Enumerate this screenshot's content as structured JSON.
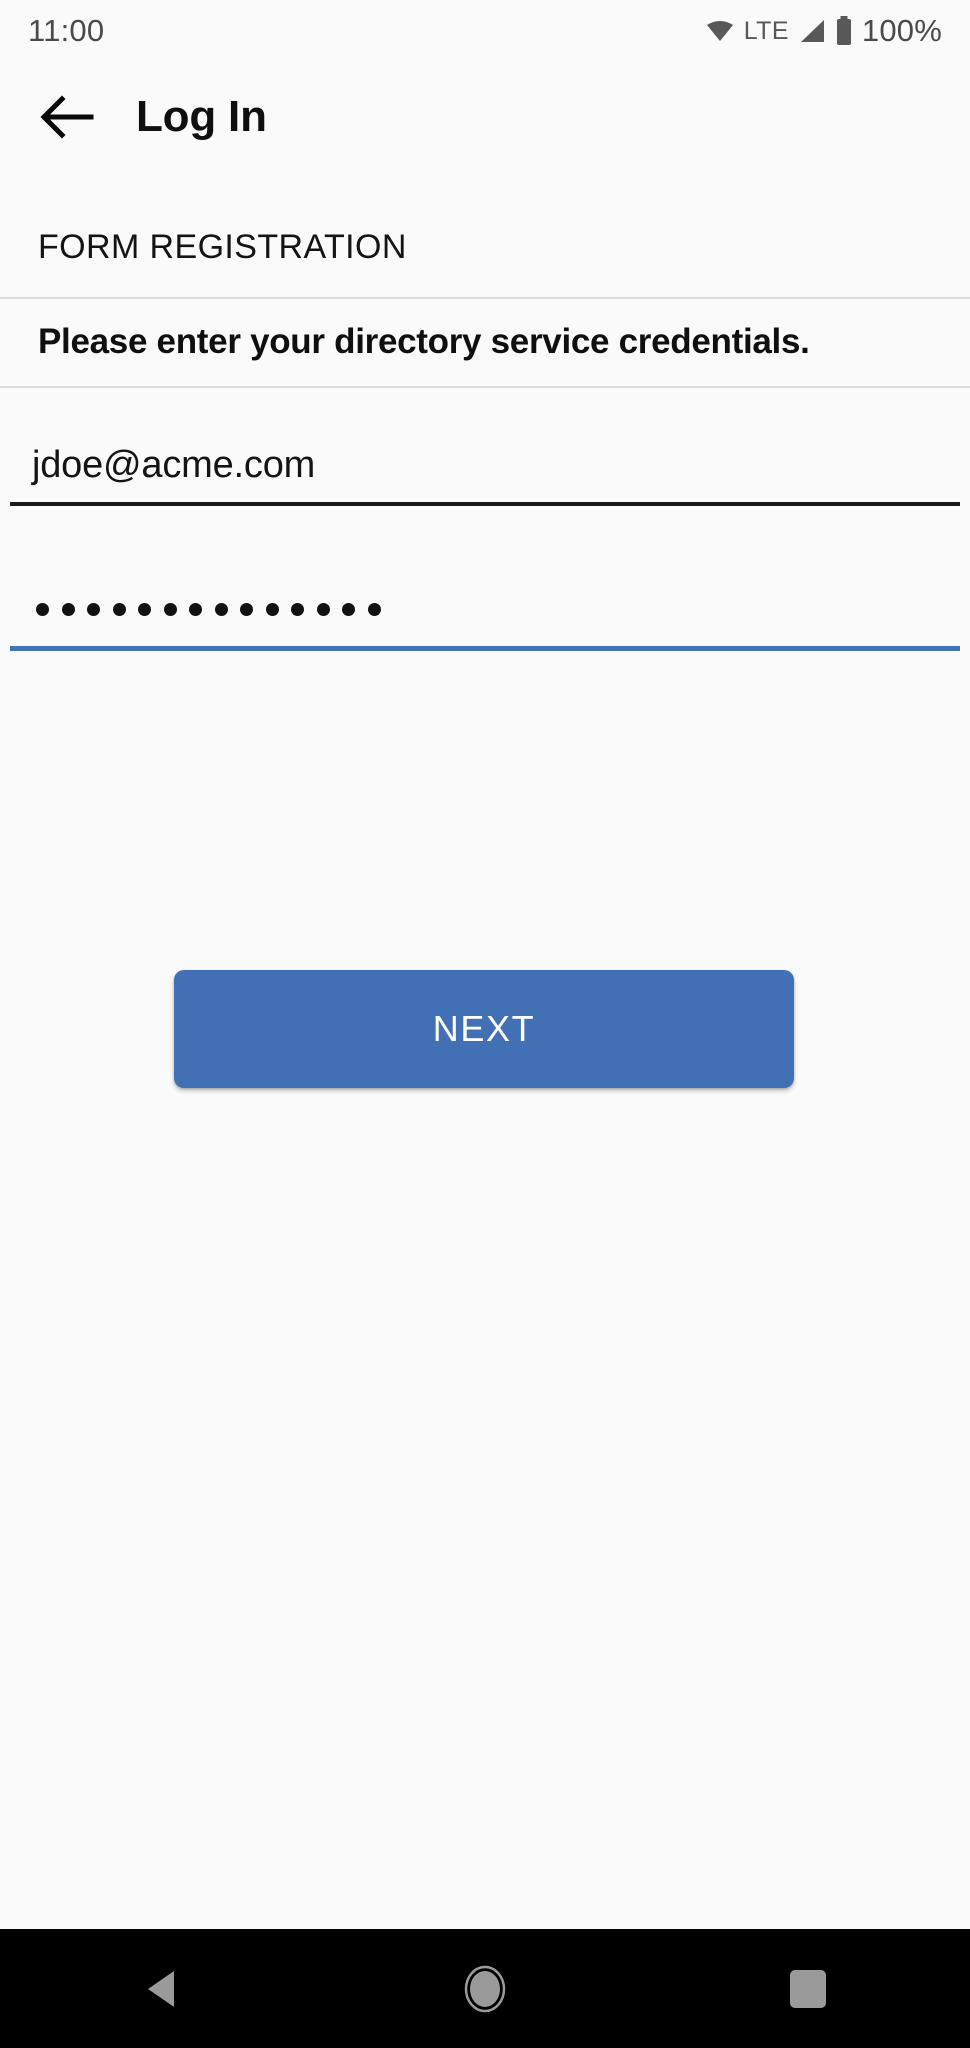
{
  "status_bar": {
    "time": "11:00",
    "network_label": "LTE",
    "battery_percent": "100%",
    "icons": {
      "wifi": "wifi-icon",
      "signal": "signal-icon",
      "battery": "battery-icon"
    }
  },
  "app_bar": {
    "back_icon": "back-arrow-icon",
    "title": "Log In"
  },
  "form": {
    "section_header": "FORM REGISTRATION",
    "instruction": "Please enter your directory service credentials.",
    "fields": [
      {
        "name": "username",
        "value": "jdoe@acme.com",
        "placeholder": "",
        "focused": false
      },
      {
        "name": "password",
        "value": "••••••••••••••",
        "masked_char_count": 14,
        "placeholder": "",
        "focused": true
      }
    ],
    "submit_label": "NEXT"
  },
  "colors": {
    "accent": "#4270b5",
    "background": "#fafafa",
    "text": "#141414",
    "divider": "#dcdcdc",
    "underline": "#1c1c1c",
    "nav_bar": "#000000",
    "nav_icon": "#9a9a9a"
  },
  "nav_bar": {
    "back_icon": "nav-back-triangle-icon",
    "home_icon": "nav-home-circle-icon",
    "recents_icon": "nav-recents-square-icon"
  }
}
